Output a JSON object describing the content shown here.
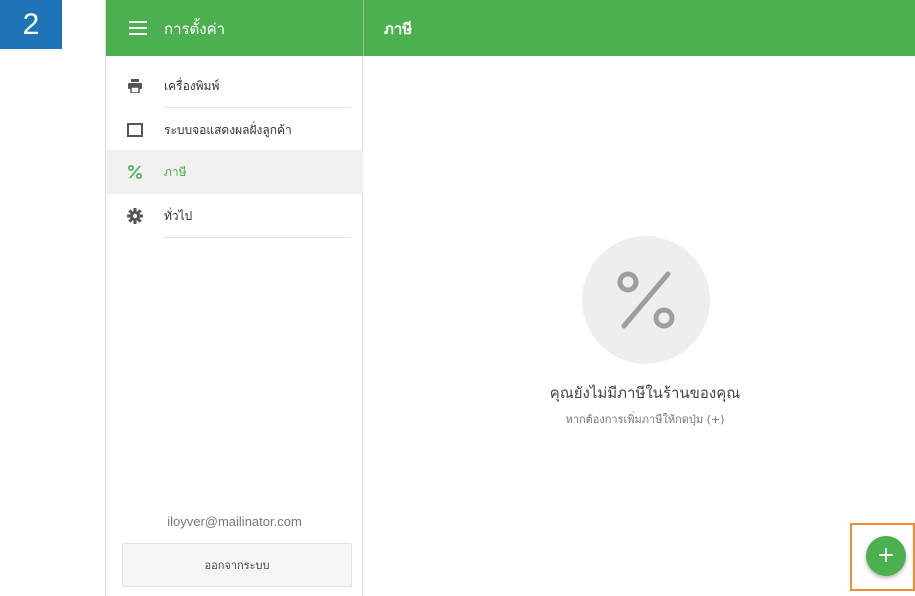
{
  "step_badge": "2",
  "topbar": {
    "menu_icon": "hamburger-icon",
    "title_left": "การตั้งค่า",
    "title_right": "ภาษี"
  },
  "sidebar": {
    "items": [
      {
        "label": "เครื่องพิมพ์",
        "icon": "printer-icon"
      },
      {
        "label": "ระบบจอแสดงผลฝั่งลูกค้า",
        "icon": "display-icon"
      },
      {
        "label": "ภาษี",
        "icon": "percent-icon",
        "active": true
      },
      {
        "label": "ทั่วไป",
        "icon": "gear-icon"
      }
    ],
    "email": "iloyver@mailinator.com",
    "logout_label": "ออกจากระบบ"
  },
  "main": {
    "empty_icon": "percent-icon",
    "empty_title": "คุณยังไม่มีภาษีในร้านของคุณ",
    "empty_hint": "หากต้องการเพิ่มภาษีให้กดปุ่ม (+)"
  },
  "fab": {
    "label": "+",
    "icon": "plus-icon"
  },
  "colors": {
    "accent": "#4caf50",
    "badge": "#1f73b7",
    "highlight": "#f08b3a"
  }
}
